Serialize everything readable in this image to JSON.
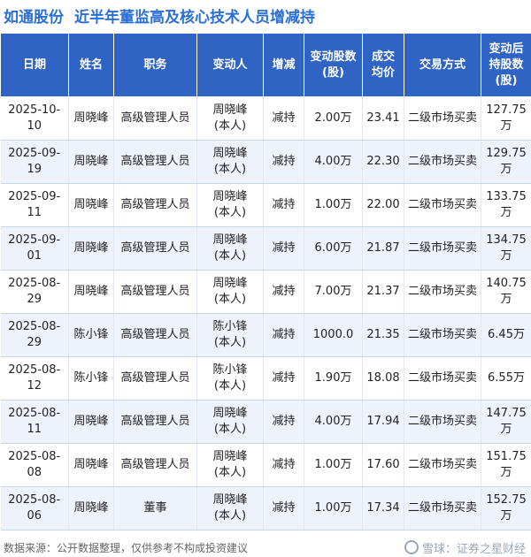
{
  "header": {
    "company": "如通股份",
    "subtitle": "近半年董监高及核心技术人员增减持"
  },
  "table": {
    "columns": [
      "日期",
      "姓名",
      "职务",
      "变动人",
      "增减",
      "变动股数\n(股)",
      "成交\n均价",
      "交易方式",
      "变动后\n持股数\n(股)"
    ],
    "rows": [
      {
        "date": "2025-10-10",
        "name": "周晓峰",
        "role": "高级管理人员",
        "actor": "周晓峰\n(本人)",
        "dir": "减持",
        "shares": "2.00万",
        "price": "23.41",
        "method": "二级市场买卖",
        "after": "127.75万"
      },
      {
        "date": "2025-09-19",
        "name": "周晓峰",
        "role": "高级管理人员",
        "actor": "周晓峰\n(本人)",
        "dir": "减持",
        "shares": "4.00万",
        "price": "22.30",
        "method": "二级市场买卖",
        "after": "129.75万"
      },
      {
        "date": "2025-09-11",
        "name": "周晓峰",
        "role": "高级管理人员",
        "actor": "周晓峰\n(本人)",
        "dir": "减持",
        "shares": "1.00万",
        "price": "22.00",
        "method": "二级市场买卖",
        "after": "133.75万"
      },
      {
        "date": "2025-09-01",
        "name": "周晓峰",
        "role": "高级管理人员",
        "actor": "周晓峰\n(本人)",
        "dir": "减持",
        "shares": "6.00万",
        "price": "21.87",
        "method": "二级市场买卖",
        "after": "134.75万"
      },
      {
        "date": "2025-08-29",
        "name": "周晓峰",
        "role": "高级管理人员",
        "actor": "周晓峰\n(本人)",
        "dir": "减持",
        "shares": "7.00万",
        "price": "21.37",
        "method": "二级市场买卖",
        "after": "140.75万"
      },
      {
        "date": "2025-08-29",
        "name": "陈小锋",
        "role": "高级管理人员",
        "actor": "陈小锋\n(本人)",
        "dir": "减持",
        "shares": "1000.0",
        "price": "21.35",
        "method": "二级市场买卖",
        "after": "6.45万"
      },
      {
        "date": "2025-08-12",
        "name": "陈小锋",
        "role": "高级管理人员",
        "actor": "陈小锋\n(本人)",
        "dir": "减持",
        "shares": "1.90万",
        "price": "18.08",
        "method": "二级市场买卖",
        "after": "6.55万"
      },
      {
        "date": "2025-08-11",
        "name": "周晓峰",
        "role": "高级管理人员",
        "actor": "周晓峰\n(本人)",
        "dir": "减持",
        "shares": "4.00万",
        "price": "17.94",
        "method": "二级市场买卖",
        "after": "147.75万"
      },
      {
        "date": "2025-08-08",
        "name": "周晓峰",
        "role": "高级管理人员",
        "actor": "周晓峰\n(本人)",
        "dir": "减持",
        "shares": "1.00万",
        "price": "17.60",
        "method": "二级市场买卖",
        "after": "151.75万"
      },
      {
        "date": "2025-08-06",
        "name": "周晓峰",
        "role": "董事",
        "actor": "周晓峰\n(本人)",
        "dir": "减持",
        "shares": "1.00万",
        "price": "17.34",
        "method": "二级市场买卖",
        "after": "152.75万"
      }
    ]
  },
  "footer": {
    "source": "数据来源：公开数据整理，仅供参考不构成投资建议",
    "brand": "雪球：证券之星财经"
  },
  "watermark": "证券之星",
  "colors": {
    "title_blue": "#2a6fd6",
    "header_bg": "#2f63c4",
    "stripe": "#eef3fb",
    "decrease_green": "#1aa04a"
  }
}
